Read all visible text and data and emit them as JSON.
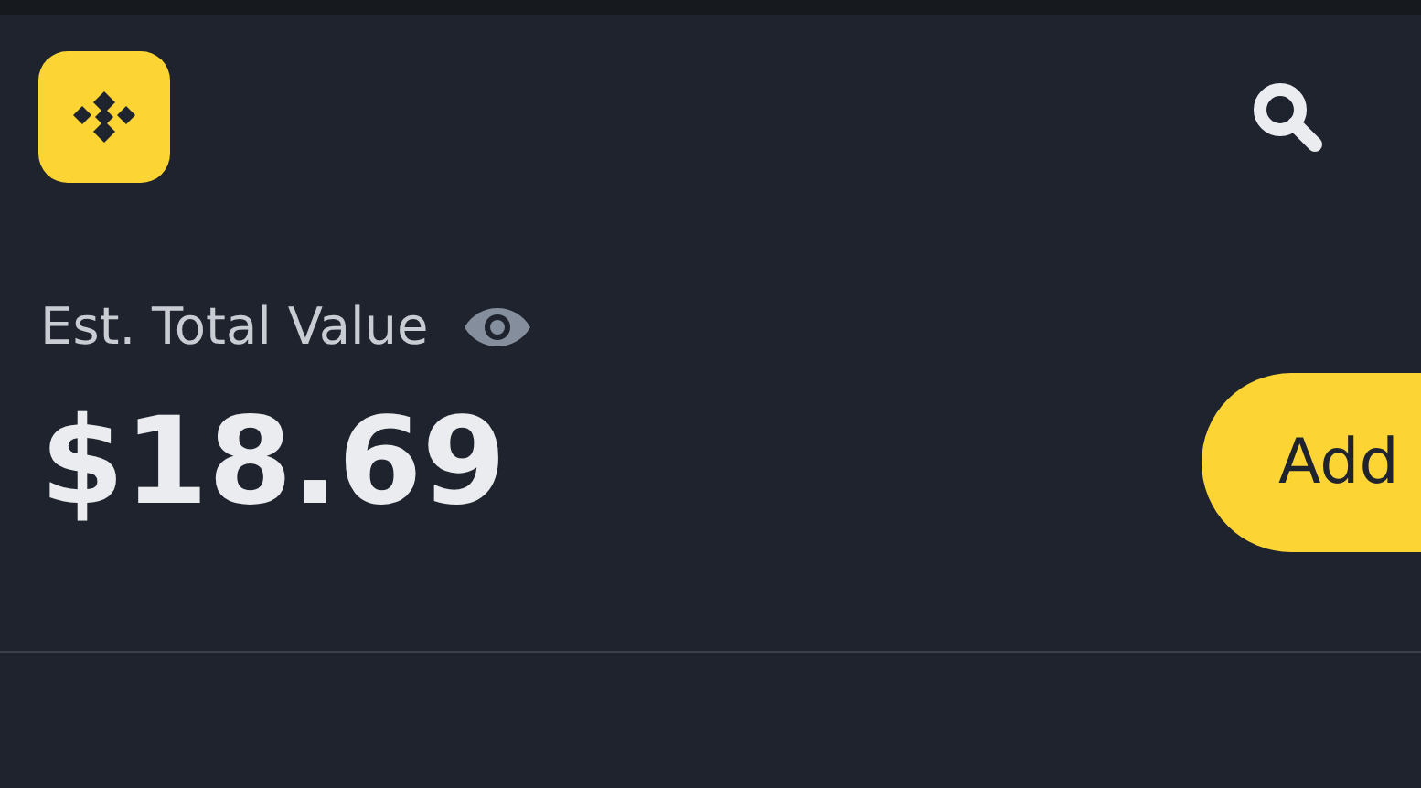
{
  "balance": {
    "label": "Est. Total Value",
    "value": "$18.69"
  },
  "add_button": {
    "label": "Add"
  }
}
